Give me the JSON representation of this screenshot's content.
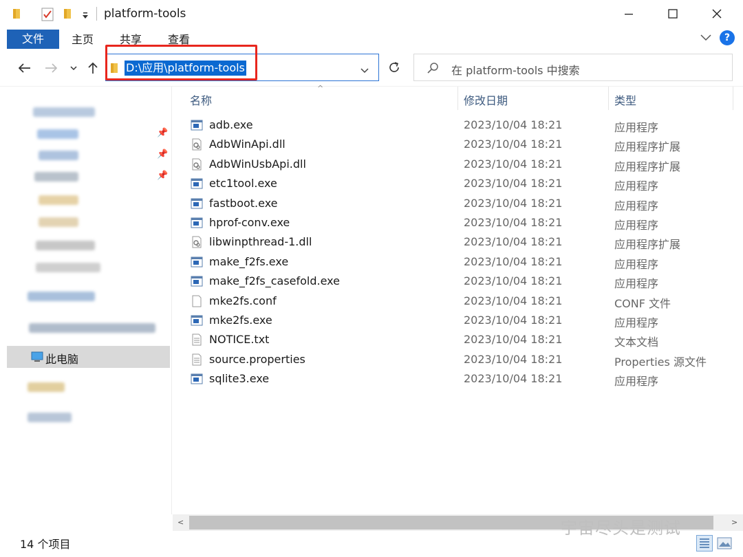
{
  "window": {
    "title": "platform-tools",
    "minimize_icon": "minimize-icon",
    "maximize_icon": "maximize-icon",
    "close_icon": "close-icon"
  },
  "ribbon": {
    "tabs": [
      "文件",
      "主页",
      "共享",
      "查看"
    ],
    "accent": "#1e62b7"
  },
  "nav": {
    "address": "D:\\应用\\platform-tools",
    "search_placeholder": "在 platform-tools 中搜索"
  },
  "sidebar": {
    "this_pc": "此电脑"
  },
  "columns": {
    "name": "名称",
    "date": "修改日期",
    "type": "类型"
  },
  "files": [
    {
      "name": "adb.exe",
      "date": "2023/10/04 18:21",
      "type": "应用程序",
      "icon": "exe"
    },
    {
      "name": "AdbWinApi.dll",
      "date": "2023/10/04 18:21",
      "type": "应用程序扩展",
      "icon": "dll"
    },
    {
      "name": "AdbWinUsbApi.dll",
      "date": "2023/10/04 18:21",
      "type": "应用程序扩展",
      "icon": "dll"
    },
    {
      "name": "etc1tool.exe",
      "date": "2023/10/04 18:21",
      "type": "应用程序",
      "icon": "exe"
    },
    {
      "name": "fastboot.exe",
      "date": "2023/10/04 18:21",
      "type": "应用程序",
      "icon": "exe"
    },
    {
      "name": "hprof-conv.exe",
      "date": "2023/10/04 18:21",
      "type": "应用程序",
      "icon": "exe"
    },
    {
      "name": "libwinpthread-1.dll",
      "date": "2023/10/04 18:21",
      "type": "应用程序扩展",
      "icon": "dll"
    },
    {
      "name": "make_f2fs.exe",
      "date": "2023/10/04 18:21",
      "type": "应用程序",
      "icon": "exe"
    },
    {
      "name": "make_f2fs_casefold.exe",
      "date": "2023/10/04 18:21",
      "type": "应用程序",
      "icon": "exe"
    },
    {
      "name": "mke2fs.conf",
      "date": "2023/10/04 18:21",
      "type": "CONF 文件",
      "icon": "blank"
    },
    {
      "name": "mke2fs.exe",
      "date": "2023/10/04 18:21",
      "type": "应用程序",
      "icon": "exe"
    },
    {
      "name": "NOTICE.txt",
      "date": "2023/10/04 18:21",
      "type": "文本文档",
      "icon": "text"
    },
    {
      "name": "source.properties",
      "date": "2023/10/04 18:21",
      "type": "Properties 源文件",
      "icon": "text"
    },
    {
      "name": "sqlite3.exe",
      "date": "2023/10/04 18:21",
      "type": "应用程序",
      "icon": "exe"
    }
  ],
  "status": {
    "count": "14 个项目"
  },
  "watermark": "宇宙尽头是测试"
}
